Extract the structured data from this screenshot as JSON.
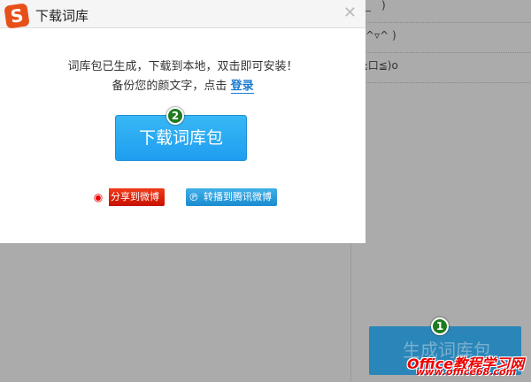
{
  "background": {
    "emoticons": [
      "￣_￣)",
      "。^▿^ )",
      "(≧口≦)o"
    ],
    "generate_button": "生成词库包"
  },
  "dialog": {
    "title": "下载词库",
    "close": "✕",
    "message_line1": "词库包已生成，下载到本地，双击即可安装！",
    "message_line2": "备份您的颜文字，点击",
    "login_link": "登录",
    "download_button": "下载词库包",
    "share_sina": "分享到微博",
    "share_tencent": "转播到腾讯微博"
  },
  "badges": {
    "step1": "1",
    "step2": "2"
  },
  "watermark": {
    "line1": "Office教程学习网",
    "line2": "www.office68.com"
  }
}
